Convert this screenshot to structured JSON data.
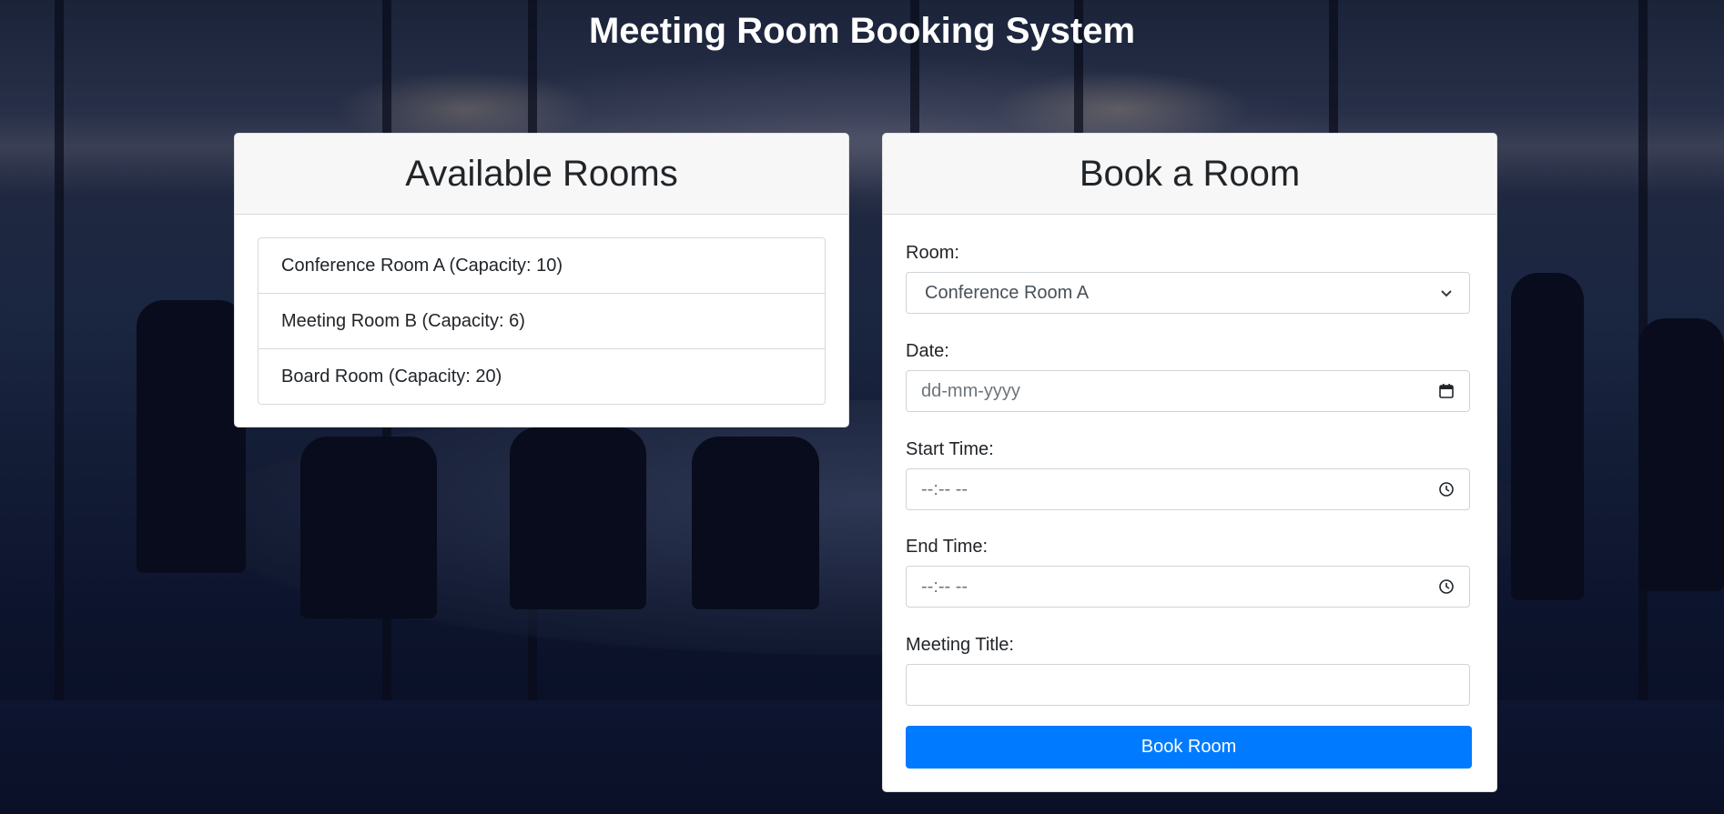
{
  "page": {
    "title": "Meeting Room Booking System"
  },
  "available_rooms": {
    "heading": "Available Rooms",
    "rooms": [
      "Conference Room A (Capacity: 10)",
      "Meeting Room B (Capacity: 6)",
      "Board Room (Capacity: 20)"
    ]
  },
  "booking_form": {
    "heading": "Book a Room",
    "room_label": "Room:",
    "room_selected": "Conference Room A",
    "date_label": "Date:",
    "date_placeholder": "dd-mm-yyyy",
    "start_label": "Start Time:",
    "start_placeholder": "--:-- --",
    "end_label": "End Time:",
    "end_placeholder": "--:-- --",
    "title_label": "Meeting Title:",
    "title_value": "",
    "submit_label": "Book Room"
  },
  "colors": {
    "primary_button": "#007bff",
    "card_header": "#f7f7f7",
    "background": "#0b1226"
  },
  "icons": {
    "select": "chevron-down-icon",
    "date": "calendar-icon",
    "time": "clock-icon"
  }
}
